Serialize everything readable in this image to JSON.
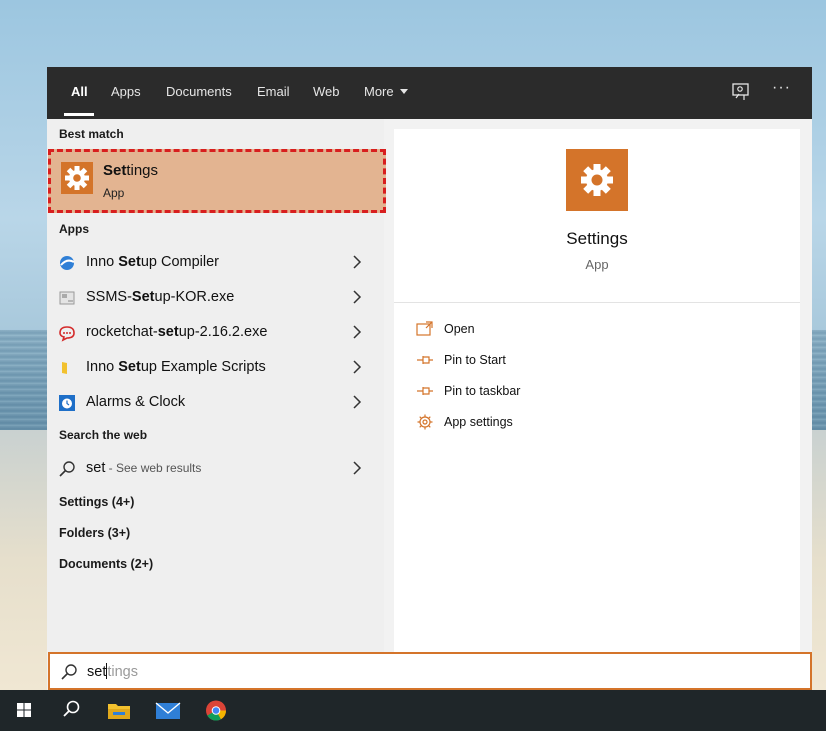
{
  "tabs": [
    {
      "label": "All",
      "active": true
    },
    {
      "label": "Apps"
    },
    {
      "label": "Documents"
    },
    {
      "label": "Email"
    },
    {
      "label": "Web"
    },
    {
      "label": "More"
    }
  ],
  "best_match": {
    "heading": "Best match",
    "title_bold": "Set",
    "title_rest": "tings",
    "subtitle": "App",
    "icon": "gear-icon"
  },
  "apps": {
    "heading": "Apps",
    "items": [
      {
        "pre": "Inno ",
        "bold": "Set",
        "post": "up Compiler",
        "icon": "inno-setup-icon"
      },
      {
        "pre": "SSMS-",
        "bold": "Set",
        "post": "up-KOR.exe",
        "icon": "installer-icon"
      },
      {
        "pre": "rocketchat-",
        "bold": "set",
        "post": "up-2.16.2.exe",
        "icon": "rocketchat-icon"
      },
      {
        "pre": "Inno ",
        "bold": "Set",
        "post": "up Example Scripts",
        "icon": "folder-icon"
      },
      {
        "pre": "Alarms & Clock",
        "bold": "",
        "post": "",
        "icon": "alarm-clock-icon"
      }
    ]
  },
  "web": {
    "heading": "Search the web",
    "query": "set",
    "suffix": " - See web results"
  },
  "categories": [
    "Settings (4+)",
    "Folders (3+)",
    "Documents (2+)"
  ],
  "preview": {
    "title": "Settings",
    "subtitle": "App",
    "actions": [
      {
        "label": "Open",
        "icon": "open-icon"
      },
      {
        "label": "Pin to Start",
        "icon": "pin-icon"
      },
      {
        "label": "Pin to taskbar",
        "icon": "pin-icon"
      },
      {
        "label": "App settings",
        "icon": "gear-icon"
      }
    ]
  },
  "search": {
    "typed": "set",
    "completion": "tings"
  },
  "colors": {
    "accent": "#d4742a",
    "highlight": "#e3b491",
    "annotation": "#d81e1e"
  }
}
